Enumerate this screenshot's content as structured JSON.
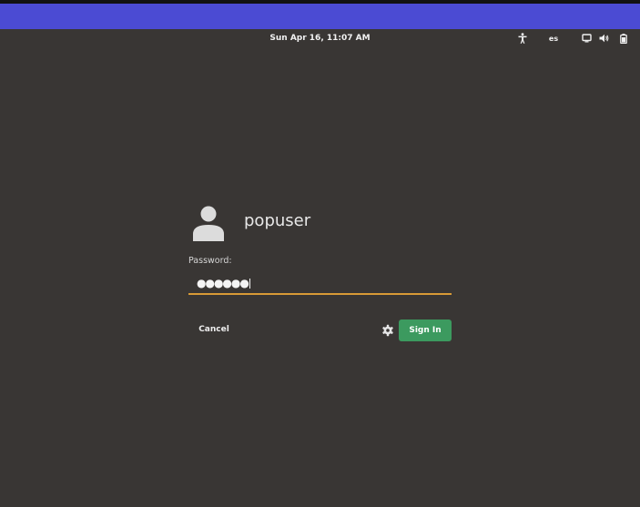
{
  "top_bar": {
    "clock": "Sun Apr 16, 11:07 AM",
    "keyboard_layout": "es",
    "icons": [
      "accessibility-icon",
      "display-icon",
      "volume-icon",
      "battery-icon"
    ]
  },
  "login": {
    "username": "popuser",
    "password_label": "Password:",
    "password_value": "●●●●●●",
    "cancel_label": "Cancel",
    "sign_in_label": "Sign In",
    "settings_icon": "gear-icon"
  },
  "colors": {
    "background": "#393634",
    "accent_bar": "#4b4bd3",
    "field_underline": "#d89a36",
    "sign_in_button": "#3c9a5f"
  }
}
